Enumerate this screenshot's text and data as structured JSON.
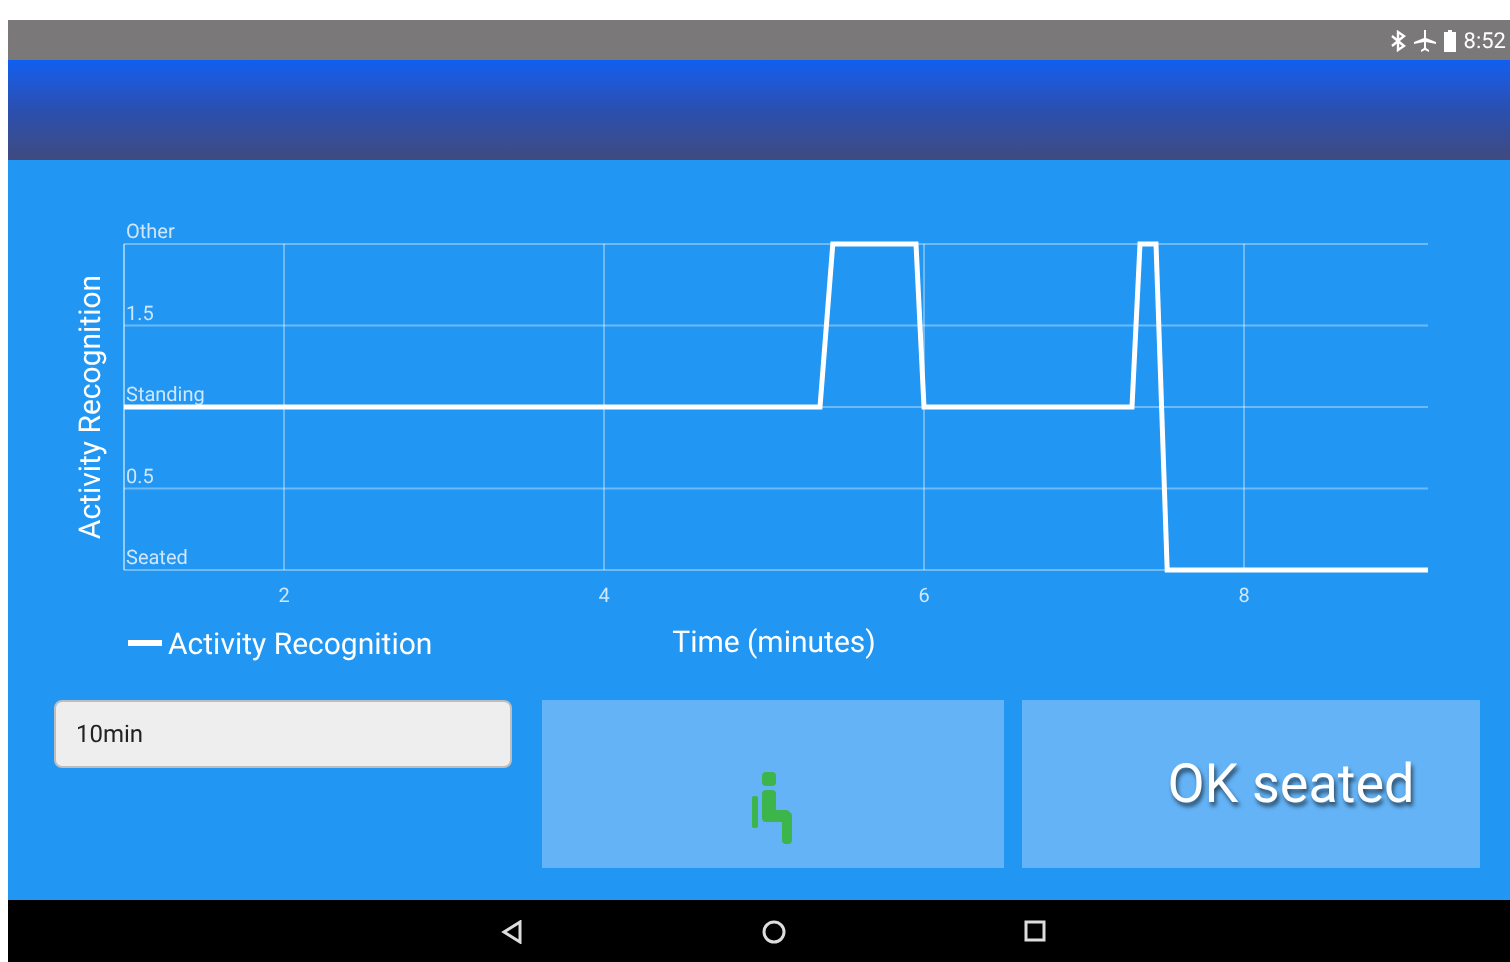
{
  "status_bar": {
    "time": "8:52"
  },
  "chart": {
    "chart_data": {
      "type": "line",
      "xlabel": "Time (minutes)",
      "ylabel": "Activity Recognition",
      "x": [
        1,
        5.35,
        5.43,
        5.95,
        6.0,
        7.3,
        7.35,
        7.45,
        7.52,
        9.15
      ],
      "series": [
        {
          "name": "Activity Recognition",
          "color": "#ffffff",
          "values": [
            1,
            1,
            2,
            2,
            1,
            1,
            2,
            2,
            0,
            0
          ]
        }
      ],
      "xlim": [
        1,
        9.15
      ],
      "ylim": [
        0,
        2
      ],
      "xticks": [
        2,
        4,
        6,
        8
      ],
      "grid": true,
      "yticks": [
        {
          "value": 0,
          "label": "Seated"
        },
        {
          "value": 0.5,
          "label": "0.5"
        },
        {
          "value": 1,
          "label": "Standing"
        },
        {
          "value": 1.5,
          "label": "1.5"
        },
        {
          "value": 2,
          "label": "Other"
        }
      ]
    }
  },
  "duration_field": {
    "value": "10min"
  },
  "posture_button": {
    "kind": "seated"
  },
  "status_button": {
    "label": "OK seated"
  }
}
